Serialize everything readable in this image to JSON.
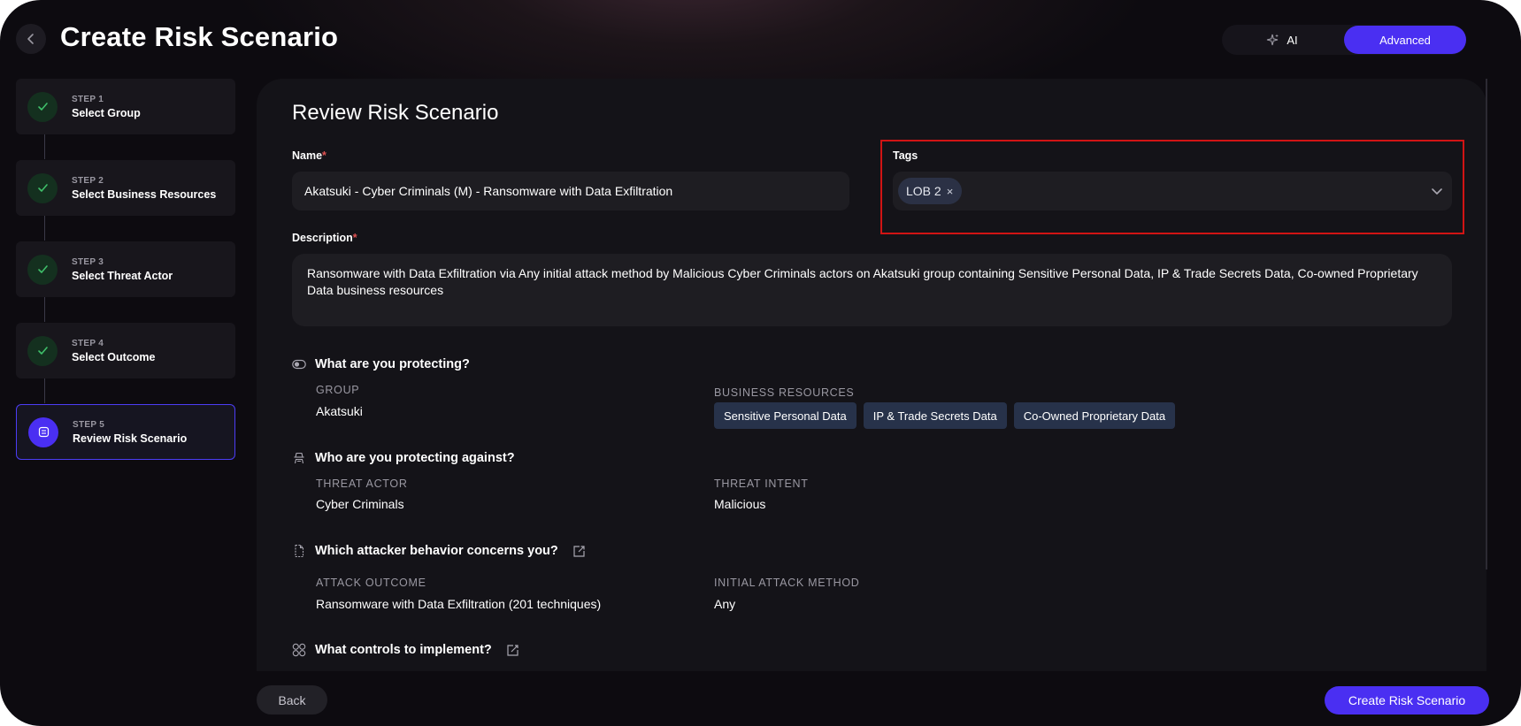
{
  "header": {
    "title": "Create Risk Scenario",
    "mode_ai_label": "AI",
    "mode_advanced_label": "Advanced"
  },
  "steps": [
    {
      "num": "STEP 1",
      "name": "Select Group",
      "state": "done"
    },
    {
      "num": "STEP 2",
      "name": "Select Business Resources",
      "state": "done"
    },
    {
      "num": "STEP 3",
      "name": "Select Threat Actor",
      "state": "done"
    },
    {
      "num": "STEP 4",
      "name": "Select Outcome",
      "state": "done"
    },
    {
      "num": "STEP 5",
      "name": "Review Risk Scenario",
      "state": "active"
    }
  ],
  "review": {
    "title": "Review Risk Scenario",
    "name_label": "Name",
    "name_value": "Akatsuki - Cyber Criminals (M) - Ransomware with Data Exfiltration",
    "tags_label": "Tags",
    "tags": [
      "LOB 2"
    ],
    "tag_remove": "×",
    "required_marker": "*",
    "description_label": "Description",
    "description_value": "Ransomware with Data Exfiltration via Any initial attack method by Malicious Cyber Criminals actors on Akatsuki group containing Sensitive Personal Data, IP & Trade Secrets Data, Co-owned Proprietary Data business resources",
    "protecting": {
      "question": "What are you protecting?",
      "group_label": "GROUP",
      "group_value": "Akatsuki",
      "resources_label": "BUSINESS RESOURCES",
      "resources": [
        "Sensitive Personal Data",
        "IP & Trade Secrets Data",
        "Co-Owned Proprietary Data"
      ]
    },
    "against": {
      "question": "Who are you protecting against?",
      "actor_label": "THREAT ACTOR",
      "actor_value": "Cyber Criminals",
      "intent_label": "THREAT INTENT",
      "intent_value": "Malicious"
    },
    "behavior": {
      "question": "Which attacker behavior concerns you?",
      "outcome_label": "ATTACK OUTCOME",
      "outcome_value": "Ransomware with Data Exfiltration (201 techniques)",
      "method_label": "INITIAL ATTACK METHOD",
      "method_value": "Any"
    },
    "controls": {
      "question": "What controls to implement?"
    }
  },
  "footer": {
    "back_label": "Back",
    "create_label": "Create Risk Scenario"
  },
  "colors": {
    "accent": "#4a2ff2",
    "done_step": "#14301f",
    "check": "#3fbf6a",
    "highlight_outline": "#d11414"
  },
  "icons": {
    "back": "chevron-left-icon",
    "ai": "sparkle-icon",
    "step_done": "check-icon",
    "step_active": "review-icon",
    "tags_dropdown": "chevron-down-icon",
    "protecting": "toggle-icon",
    "against": "hacker-icon",
    "behavior": "document-icon",
    "controls": "grid-icon",
    "edit": "external-edit-icon"
  }
}
